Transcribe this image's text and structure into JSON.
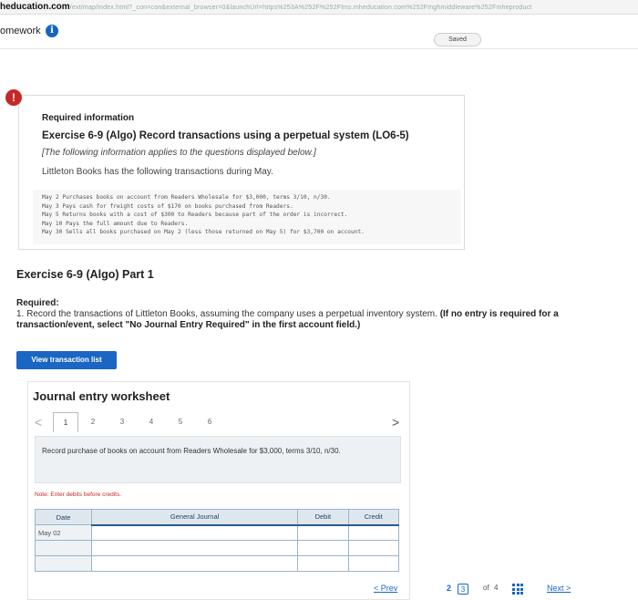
{
  "browser": {
    "domain": "heducation.com",
    "path": "/ext/map/index.html?_con=con&external_browser=0&launchUrl=https%253A%252F%252Flms.mheducation.com%252Fmghmiddleware%252Fmheproduct"
  },
  "header": {
    "homework_label": "omework",
    "info_icon": "i",
    "saved_label": "Saved"
  },
  "info_card": {
    "alert_icon": "!",
    "required_info": "Required information",
    "title": "Exercise 6-9 (Algo) Record transactions using a perpetual system (LO6-5)",
    "note": "[The following information applies to the questions displayed below.]",
    "intro": "Littleton Books has the following transactions during May.",
    "transactions": [
      "May  2 Purchases books on account from Readers Wholesale for $3,000, terms 3/10, n/30.",
      "May  3 Pays cash for freight costs of $170 on books purchased from Readers.",
      "May  5 Returns books with a cost of $300 to Readers because part of the order is incorrect.",
      "May 10 Pays the full amount due to Readers.",
      "May 30 Sells all books purchased on May 2 (less those returned on May 5) for $3,700 on account."
    ]
  },
  "part": {
    "title": "Exercise 6-9 (Algo) Part 1",
    "required_label": "Required:",
    "required_text": "1. Record the transactions of Littleton Books, assuming the company uses a perpetual inventory system.",
    "required_bold": "(If no entry is required for a transaction/event, select \"No Journal Entry Required\" in the first account field.)"
  },
  "buttons": {
    "view_transaction_list": "View transaction list"
  },
  "worksheet": {
    "title": "Journal entry worksheet",
    "prev_arrow": "<",
    "next_arrow": ">",
    "pages": [
      "1",
      "2",
      "3",
      "4",
      "5",
      "6"
    ],
    "active_page": "1",
    "task_text": "Record purchase of books on account from Readers Wholesale for $3,000, terms 3/10, n/30.",
    "note": "Note: Enter debits before credits.",
    "columns": [
      "Date",
      "General Journal",
      "Debit",
      "Credit"
    ],
    "rows": [
      [
        "May 02",
        "",
        "",
        ""
      ],
      [
        "",
        "",
        "",
        ""
      ],
      [
        "",
        "",
        "",
        ""
      ]
    ]
  },
  "pager": {
    "prev_label": "Prev",
    "prev_arrow": "<",
    "page_left": "2",
    "page_current": "3",
    "of_label": "of",
    "total": "4",
    "next_label": "Next",
    "next_arrow": ">"
  }
}
